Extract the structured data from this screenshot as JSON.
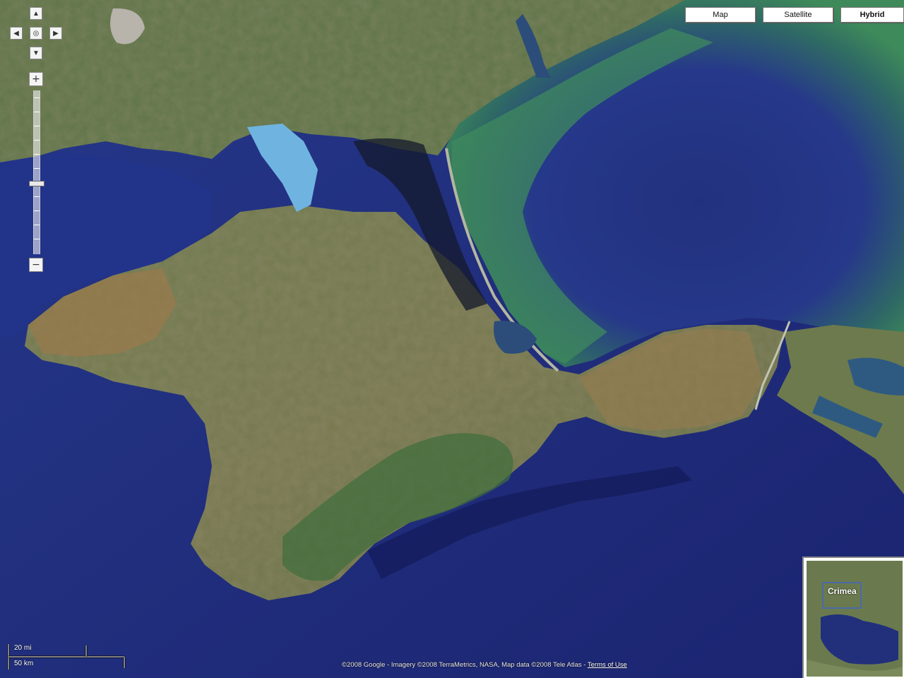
{
  "map_type_controls": [
    {
      "label": "Map",
      "selected": false
    },
    {
      "label": "Satellite",
      "selected": false
    },
    {
      "label": "Hybrid",
      "selected": true
    }
  ],
  "zoom": {
    "plus": "+",
    "minus": "−"
  },
  "scale": {
    "top": "20 mi",
    "bottom": "50 km"
  },
  "copyright": {
    "text": "©2008 Google - Imagery ©2008 TerraMetrics, NASA, Map data ©2008 Tele Atlas - ",
    "terms": "Terms of Use"
  },
  "overview": {
    "label": "Crimea"
  },
  "colors": {
    "sea": "#1f2f7e",
    "sea_deep": "#16206a",
    "shallow": "#3d8a5e",
    "land": "#6f7a4e",
    "land_dry": "#9a7a4e"
  }
}
